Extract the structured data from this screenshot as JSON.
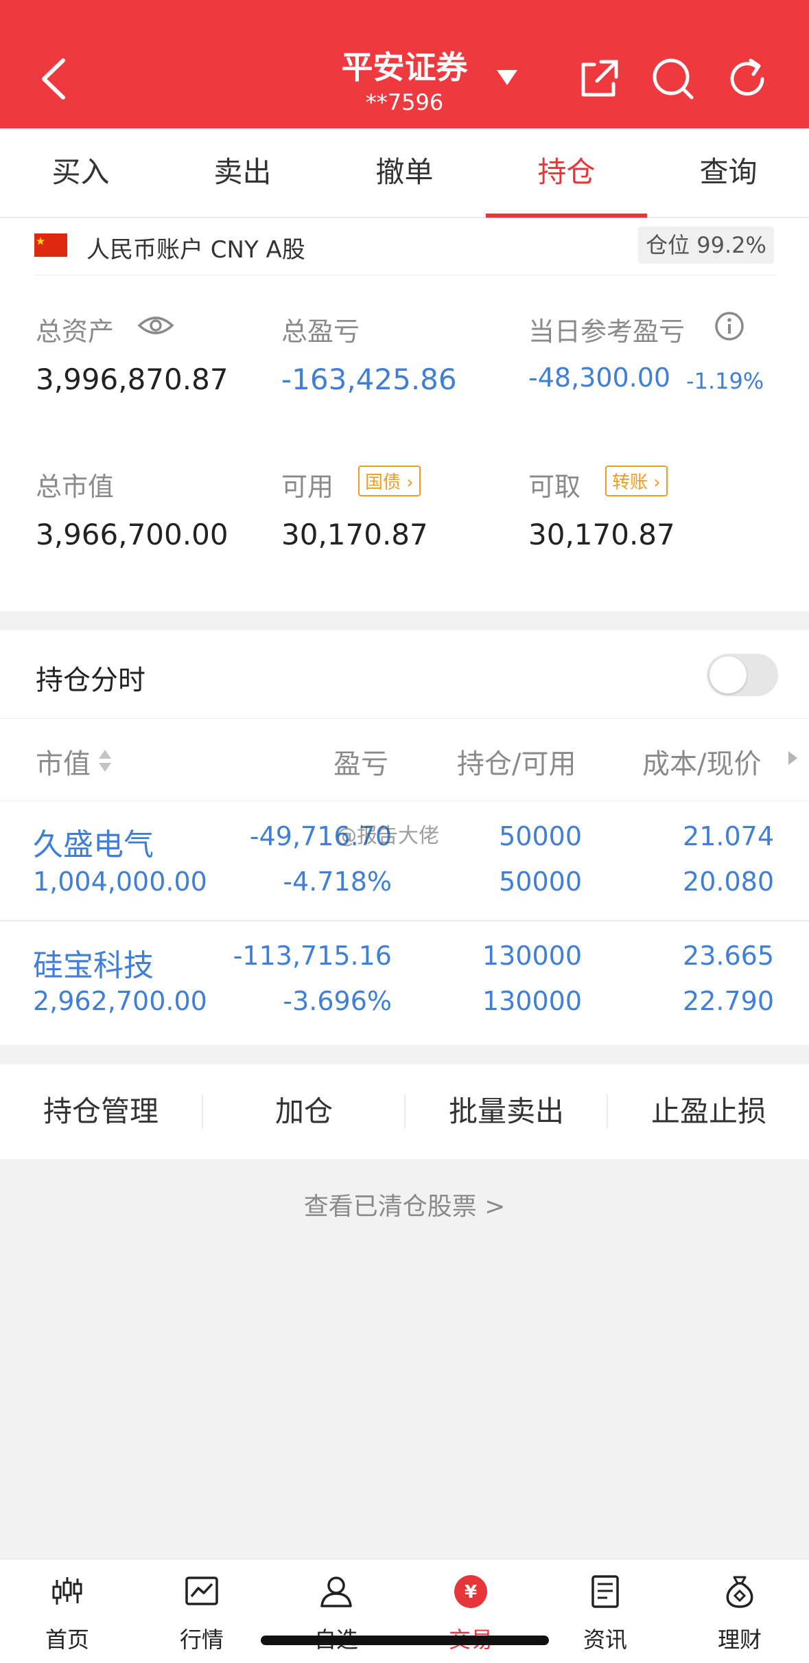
{
  "header": {
    "title": "平安证券",
    "account": "**7596",
    "colors": {
      "brand": "#ee3a3e",
      "accent": "#e8353a",
      "blue": "#3f7fd7",
      "orange": "#f39b21"
    },
    "icons": [
      "back-arrow-icon",
      "dropdown-caret-icon",
      "share-icon",
      "search-icon",
      "refresh-icon"
    ]
  },
  "tabs": [
    {
      "label": "买入"
    },
    {
      "label": "卖出"
    },
    {
      "label": "撤单"
    },
    {
      "label": "持仓",
      "active": true
    },
    {
      "label": "查询"
    }
  ],
  "account_bar": {
    "label": "人民币账户 CNY A股",
    "position_label": "仓位 99.2%"
  },
  "summary": {
    "total_assets_label": "总资产",
    "total_assets": "3,996,870.87",
    "total_pnl_label": "总盈亏",
    "total_pnl": "-163,425.86",
    "daily_pnl_label": "当日参考盈亏",
    "daily_pnl": "-48,300.00",
    "daily_pnl_pct": "-1.19%",
    "market_value_label": "总市值",
    "market_value": "3,966,700.00",
    "available_label": "可用",
    "available": "30,170.87",
    "bond_button": "国债",
    "withdrawable_label": "可取",
    "withdrawable": "30,170.87",
    "transfer_button": "转账"
  },
  "holdings": {
    "title": "持仓分时",
    "toggle_on": false,
    "columns": [
      "市值",
      "盈亏",
      "持仓/可用",
      "成本/现价"
    ],
    "rows": [
      {
        "name": "久盛电气",
        "market_value": "1,004,000.00",
        "pnl": "-49,716.70",
        "pnl_pct": "-4.718%",
        "position": "50000",
        "available": "50000",
        "cost": "21.074",
        "price": "20.080"
      },
      {
        "name": "硅宝科技",
        "market_value": "2,962,700.00",
        "pnl": "-113,715.16",
        "pnl_pct": "-3.696%",
        "position": "130000",
        "available": "130000",
        "cost": "23.665",
        "price": "22.790"
      }
    ]
  },
  "actions": [
    "持仓管理",
    "加仓",
    "批量卖出",
    "止盈止损"
  ],
  "cleared_link": "查看已清仓股票 >",
  "watermark": "@报告大佬",
  "nav": [
    {
      "label": "首页",
      "icon": "candlestick-icon"
    },
    {
      "label": "行情",
      "icon": "chart-icon"
    },
    {
      "label": "自选",
      "icon": "user-star-icon"
    },
    {
      "label": "交易",
      "icon": "yuan-icon",
      "active": true,
      "glyph": "¥"
    },
    {
      "label": "资讯",
      "icon": "document-icon"
    },
    {
      "label": "理财",
      "icon": "money-bag-icon"
    }
  ]
}
